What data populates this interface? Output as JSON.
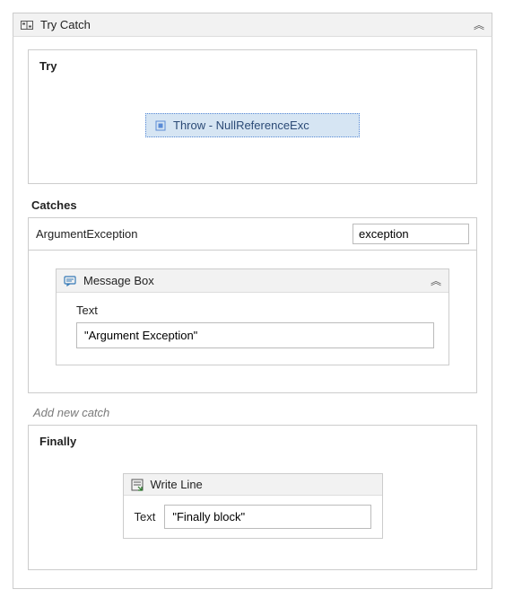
{
  "header": {
    "title": "Try Catch",
    "chevron": "︽"
  },
  "try": {
    "label": "Try",
    "throw_label": "Throw - NullReferenceExc"
  },
  "catches": {
    "heading": "Catches",
    "items": [
      {
        "type": "ArgumentException",
        "var_name": "exception",
        "activity": {
          "title": "Message Box",
          "chevron": "︽",
          "text_label": "Text",
          "text_value": "\"Argument Exception\""
        }
      }
    ],
    "add_label": "Add new catch"
  },
  "finally": {
    "label": "Finally",
    "activity": {
      "title": "Write Line",
      "text_label": "Text",
      "text_value": "\"Finally block\""
    }
  }
}
